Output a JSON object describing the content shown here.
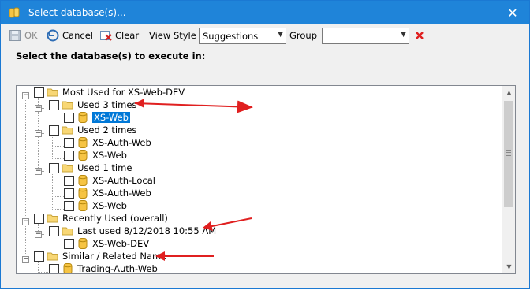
{
  "window": {
    "title": "Select database(s)...",
    "close_glyph": "✕"
  },
  "toolbar": {
    "ok_label": "OK",
    "cancel_label": "Cancel",
    "clear_label": "Clear",
    "view_style_label": "View Style",
    "view_style_value": "Suggestions",
    "group_label": "Group",
    "group_value": ""
  },
  "prompt": "Select the database(s) to execute in:",
  "tree": {
    "most_used": "Most Used for XS-Web-DEV",
    "used3": "Used 3 times",
    "xsweb_a": "XS-Web",
    "used2": "Used 2 times",
    "xsauthweb_a": "XS-Auth-Web",
    "xsweb_b": "XS-Web",
    "used1": "Used 1 time",
    "xsauthlocal": "XS-Auth-Local",
    "xsauthweb_b": "XS-Auth-Web",
    "xsweb_c": "XS-Web",
    "recently_used": "Recently Used (overall)",
    "last_used": "Last used 8/12/2018 10:55 AM",
    "xswebdev": "XS-Web-DEV",
    "similar": "Similar / Related Name",
    "tradingauthweb": "Trading-Auth-Web"
  },
  "colors": {
    "titlebar": "#1f84d9",
    "selection": "#0078d7",
    "annotation_arrow": "#e02020"
  },
  "icons": [
    "database-icon",
    "folder-icon",
    "checkbox",
    "expander-minus-icon"
  ]
}
